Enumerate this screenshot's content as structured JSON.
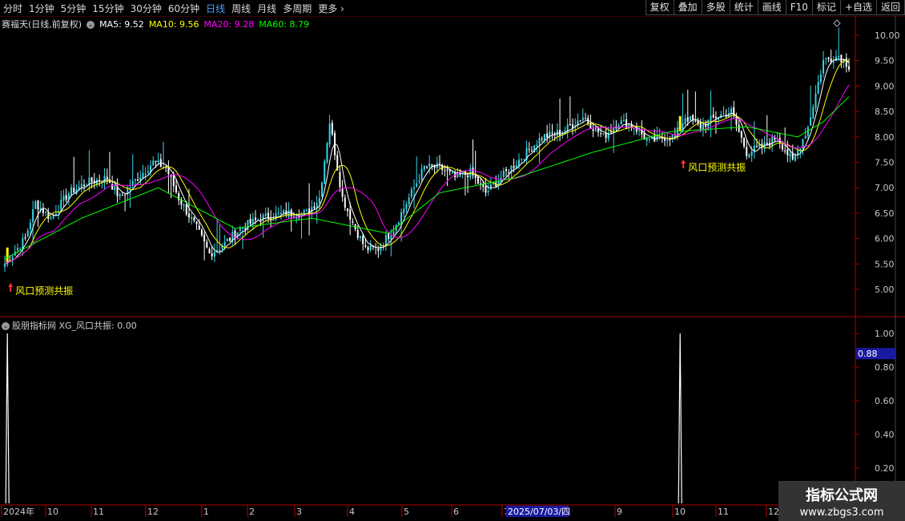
{
  "toolbar": {
    "left": [
      "分时",
      "1分钟",
      "5分钟",
      "15分钟",
      "30分钟",
      "60分钟",
      "日线",
      "周线",
      "月线",
      "多周期",
      "更多"
    ],
    "active": "日线",
    "right": [
      "复权",
      "叠加",
      "多股",
      "统计",
      "画线",
      "F10",
      "标记",
      "+自选",
      "返回"
    ]
  },
  "header": {
    "stock": "赛福天(日线,前复权)",
    "ma5": "MA5: 9.52",
    "ma10": "MA10: 9.56",
    "ma20": "MA20: 9.28",
    "ma60": "MA60: 8.79"
  },
  "colors": {
    "ma5": "#ffffff",
    "ma10": "#ffff00",
    "ma20": "#ff00ff",
    "ma60": "#00ff00",
    "candle": "#36d6e7",
    "signal": "#ff3333",
    "annotation": "#ffff00",
    "axis": "#b00000"
  },
  "price_axis": [
    "10.00",
    "9.50",
    "9.00",
    "8.50",
    "8.00",
    "7.50",
    "7.00",
    "6.50",
    "6.00",
    "5.50",
    "5.00"
  ],
  "annotations": [
    {
      "label": "风口预测共振"
    },
    {
      "label": "风口预测共振"
    }
  ],
  "indicator": {
    "title": "股朋指标网 XG_风口共振: 0.00",
    "axis": [
      "1.00",
      "0.80",
      "0.60",
      "0.40",
      "0.20"
    ],
    "cursor_value": "0.88"
  },
  "date_axis": {
    "labels": [
      "2024年",
      "10",
      "11",
      "12",
      "1",
      "2",
      "3",
      "4",
      "5",
      "6",
      "7",
      "9",
      "10",
      "11",
      "12"
    ],
    "cursor_date": "2025/07/03/四"
  },
  "watermark": {
    "line1": "指标公式网",
    "line2": "www.zbgs3.com"
  },
  "chart_data": {
    "type": "candlestick",
    "ylim": [
      4.7,
      10.2
    ],
    "ma_last": {
      "MA5": 9.52,
      "MA10": 9.56,
      "MA20": 9.28,
      "MA60": 8.79
    },
    "close_keypoints": [
      [
        0,
        5.5
      ],
      [
        8,
        6.0
      ],
      [
        12,
        6.7
      ],
      [
        18,
        6.4
      ],
      [
        25,
        6.9
      ],
      [
        32,
        7.1
      ],
      [
        40,
        7.2
      ],
      [
        45,
        6.8
      ],
      [
        52,
        7.2
      ],
      [
        58,
        7.5
      ],
      [
        63,
        7.4
      ],
      [
        68,
        6.8
      ],
      [
        75,
        6.2
      ],
      [
        80,
        5.7
      ],
      [
        86,
        5.9
      ],
      [
        92,
        6.2
      ],
      [
        100,
        6.4
      ],
      [
        110,
        6.5
      ],
      [
        118,
        6.5
      ],
      [
        123,
        6.8
      ],
      [
        127,
        8.3
      ],
      [
        132,
        6.8
      ],
      [
        137,
        6.2
      ],
      [
        141,
        5.8
      ],
      [
        146,
        5.8
      ],
      [
        152,
        6.2
      ],
      [
        158,
        6.8
      ],
      [
        164,
        7.4
      ],
      [
        170,
        7.4
      ],
      [
        176,
        7.2
      ],
      [
        182,
        7.3
      ],
      [
        188,
        6.9
      ],
      [
        194,
        7.2
      ],
      [
        202,
        7.6
      ],
      [
        210,
        8.0
      ],
      [
        218,
        8.1
      ],
      [
        226,
        8.4
      ],
      [
        234,
        8.0
      ],
      [
        240,
        8.3
      ],
      [
        246,
        8.2
      ],
      [
        252,
        7.9
      ],
      [
        258,
        8.0
      ],
      [
        262,
        8.0
      ],
      [
        266,
        8.4
      ],
      [
        272,
        8.2
      ],
      [
        278,
        8.4
      ],
      [
        284,
        8.5
      ],
      [
        290,
        7.7
      ],
      [
        296,
        7.8
      ],
      [
        302,
        8.0
      ],
      [
        308,
        7.5
      ],
      [
        314,
        8.2
      ],
      [
        320,
        9.5
      ],
      [
        326,
        9.6
      ],
      [
        330,
        9.4
      ]
    ],
    "ma60_keypoints": [
      [
        0,
        5.6
      ],
      [
        30,
        6.4
      ],
      [
        60,
        7.0
      ],
      [
        90,
        6.2
      ],
      [
        120,
        6.4
      ],
      [
        140,
        6.2
      ],
      [
        150,
        6.1
      ],
      [
        170,
        6.9
      ],
      [
        200,
        7.2
      ],
      [
        230,
        7.7
      ],
      [
        260,
        8.1
      ],
      [
        290,
        8.2
      ],
      [
        310,
        8.0
      ],
      [
        320,
        8.3
      ],
      [
        330,
        8.79
      ]
    ],
    "signals": [
      {
        "bar": 1,
        "value": 1
      },
      {
        "bar": 264,
        "value": 1
      }
    ],
    "indicator_ylim": [
      0,
      1.05
    ]
  }
}
